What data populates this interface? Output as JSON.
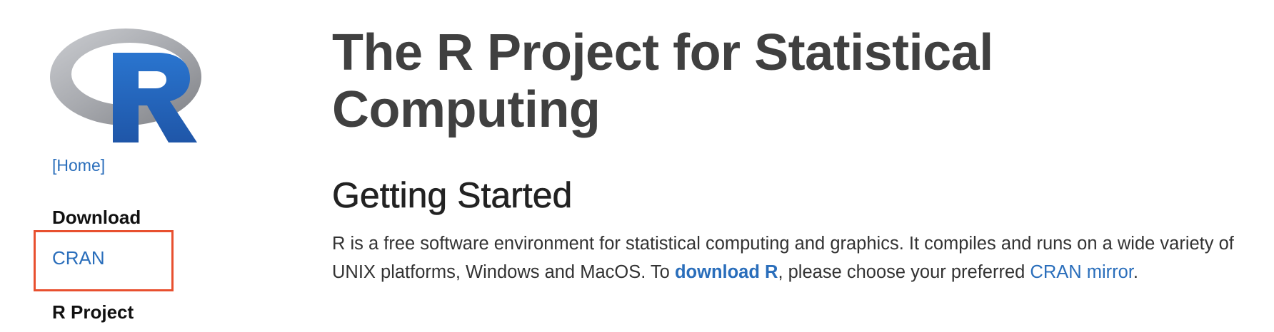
{
  "sidebar": {
    "home_label": "[Home]",
    "download_heading": "Download",
    "cran_label": "CRAN",
    "rproject_heading": "R Project"
  },
  "main": {
    "title": "The R Project for Statistical Computing",
    "section_title": "Getting Started",
    "intro": {
      "part1": "R is a free software environment for statistical computing and graphics. It compiles and runs on a wide variety of UNIX platforms, Windows and MacOS. To ",
      "download_link": "download R",
      "part2": ", please choose your preferred ",
      "mirror_link": "CRAN mirror",
      "part3": "."
    }
  },
  "colors": {
    "link": "#2a6ebb",
    "highlight": "#e8502f",
    "logo_blue": "#2166bf",
    "logo_gray": "#a9abb1"
  },
  "icons": {
    "logo": "r-logo-icon"
  }
}
